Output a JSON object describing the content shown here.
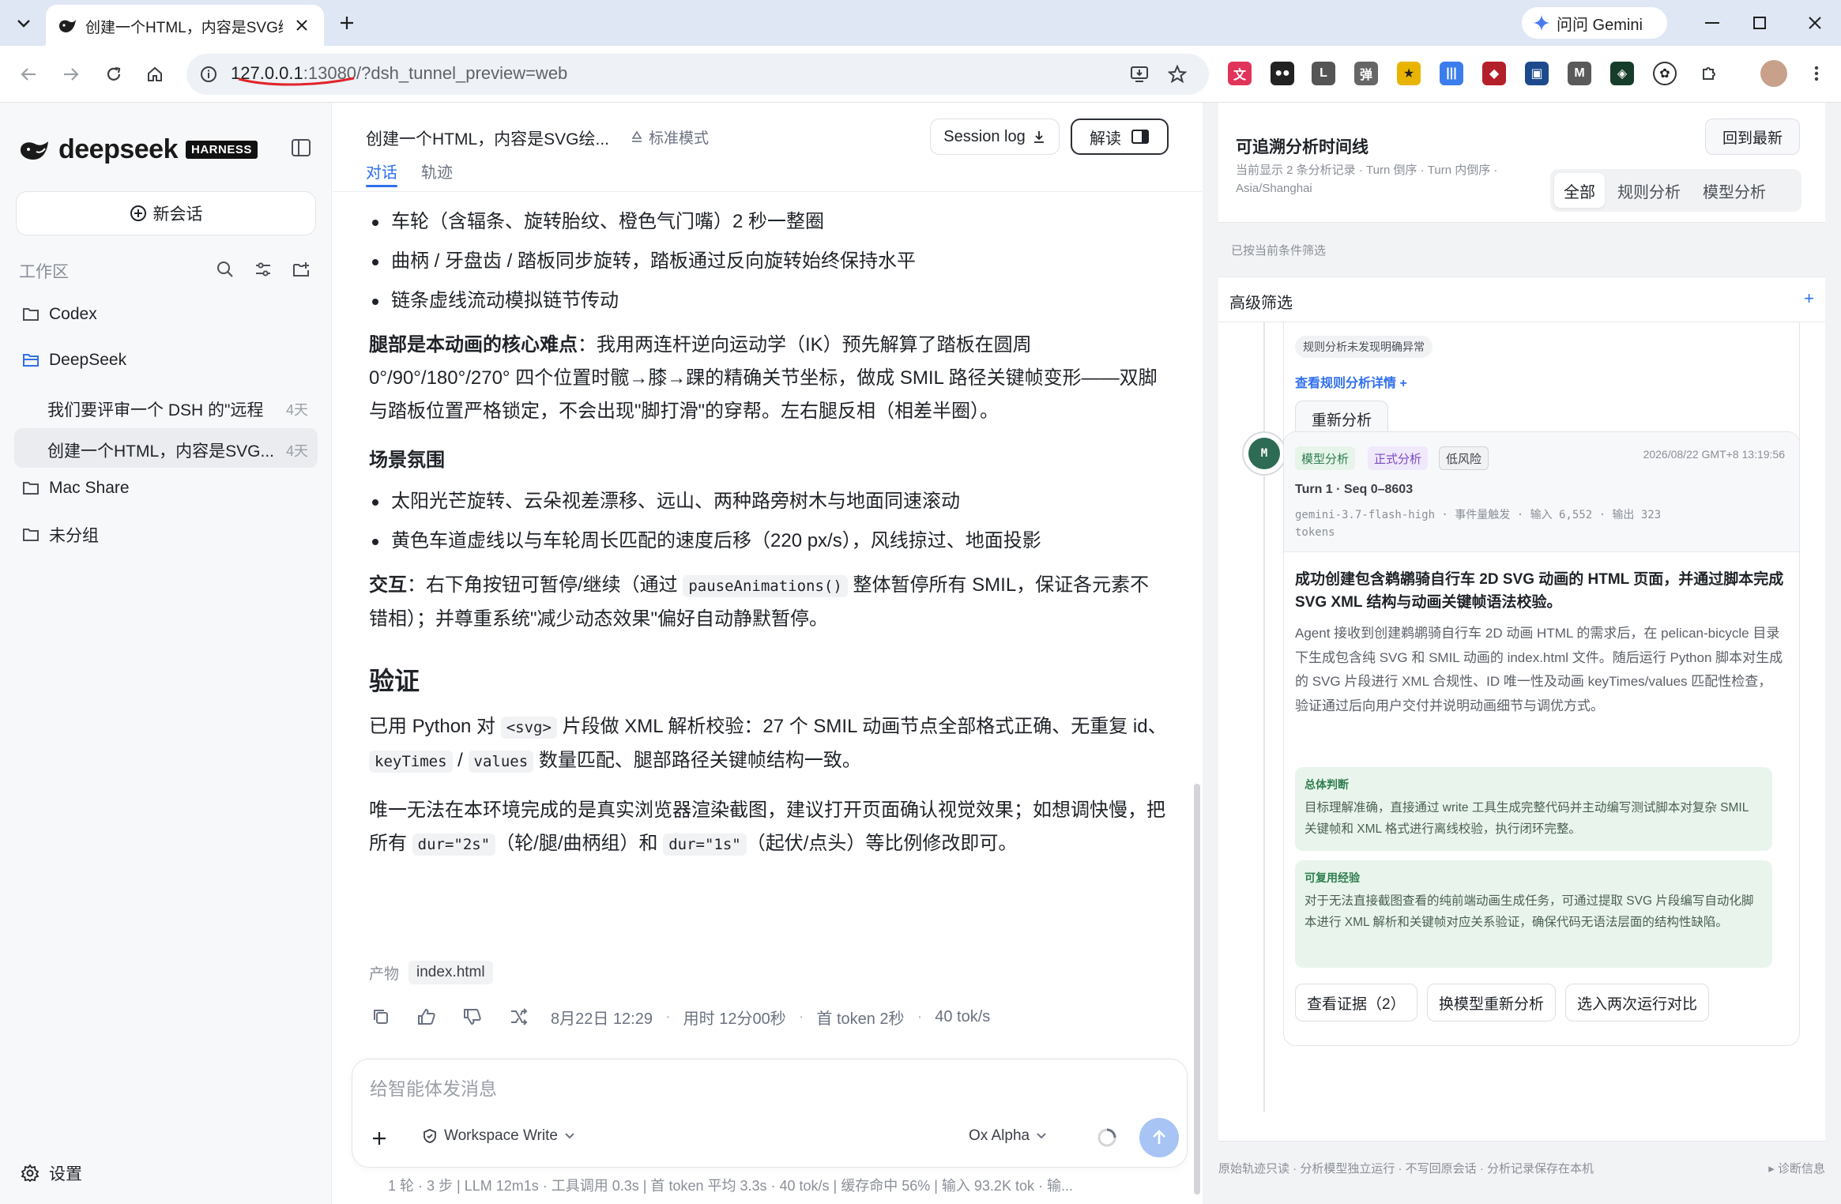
{
  "browser": {
    "tab_title": "创建一个HTML，内容是SVG绘",
    "gemini_label": "问问 Gemini",
    "url_host": "127.0.0.1",
    "url_rest": ":13080/?dsh_tunnel_preview=web"
  },
  "sidebar": {
    "brand": "deepseek",
    "badge": "HARNESS",
    "new_chat": "新会话",
    "workspace_label": "工作区",
    "folders": [
      {
        "label": "Codex"
      },
      {
        "label": "DeepSeek"
      },
      {
        "label": "Mac Share"
      },
      {
        "label": "未分组"
      }
    ],
    "conversations": [
      {
        "title": "我们要评审一个 DSH 的\"远程",
        "age": "4天"
      },
      {
        "title": "创建一个HTML，内容是SVG...",
        "age": "4天"
      }
    ],
    "settings": "设置"
  },
  "center": {
    "chat_title": "创建一个HTML，内容是SVG绘...",
    "mode": "标准模式",
    "session_log": "Session log",
    "interpret": "解读",
    "tabs": [
      "对话",
      "轨迹"
    ],
    "bullets1": [
      "车轮（含辐条、旋转胎纹、橙色气门嘴）2 秒一整圈",
      "曲柄 / 牙盘齿 / 踏板同步旋转，踏板通过反向旋转始终保持水平",
      "链条虚线流动模拟链节传动"
    ],
    "legs_bold": "腿部是本动画的核心难点",
    "legs_text": "：我用两连杆逆向运动学（IK）预先解算了踏板在圆周 0°/90°/180°/270° 四个位置时髋→膝→踝的精确关节坐标，做成 SMIL 路径关键帧变形——双脚与踏板位置严格锁定，不会出现\"脚打滑\"的穿帮。左右腿反相（相差半圈）。",
    "scene_heading": "场景氛围",
    "bullets2": [
      "太阳光芒旋转、云朵视差漂移、远山、两种路旁树木与地面同速滚动",
      "黄色车道虚线以与车轮周长匹配的速度后移（220 px/s），风线掠过、地面投影"
    ],
    "interact_bold": "交互",
    "interact_1": "：右下角按钮可暂停/继续（通过 ",
    "interact_code": "pauseAnimations()",
    "interact_2": " 整体暂停所有 SMIL，保证各元素不错相）；并尊重系统\"减少动态效果\"偏好自动静默暂停。",
    "verify_heading": "验证",
    "verify_1": "已用 Python 对 ",
    "verify_code1": "<svg>",
    "verify_2": " 片段做 XML 解析校验：27 个 SMIL 动画节点全部格式正确、无重复 id、",
    "verify_code2": "keyTimes",
    "verify_3": " / ",
    "verify_code3": "values",
    "verify_4": " 数量匹配、腿部路径关键帧结构一致。",
    "note_1": "唯一无法在本环境完成的是真实浏览器渲染截图，建议打开页面确认视觉效果；如想调快慢，把所有 ",
    "note_code1": "dur=\"2s\"",
    "note_2": "（轮/腿/曲柄组）和 ",
    "note_code2": "dur=\"1s\"",
    "note_3": "（起伏/点头）等比例修改即可。",
    "artifact_label": "产物",
    "artifact_file": "index.html",
    "meta_time": "8月22日 12:29",
    "meta_duration": "用时 12分00秒",
    "meta_first_token": "首 token 2秒",
    "meta_speed": "40 tok/s",
    "composer_placeholder": "给智能体发消息",
    "workspace_write": "Workspace Write",
    "model": "Ox Alpha",
    "stats": "1 轮 · 3 步  |  LLM 12m1s · 工具调用 0.3s  |  首 token 平均 3.3s · 40 tok/s  |  缓存命中 56%  |  输入 93.2K tok · 输..."
  },
  "panel": {
    "title": "可追溯分析时间线",
    "subtitle": "当前显示 2 条分析记录 · Turn 倒序 · Turn 内倒序 · Asia/Shanghai",
    "back_latest": "回到最新",
    "filters": [
      "全部",
      "规则分析",
      "模型分析"
    ],
    "filter_note": "已按当前条件筛选",
    "advanced": "高级筛选",
    "rule_chip": "规则分析未发现明确异常",
    "rule_detail": "查看规则分析详情 +",
    "reanalyze": "重新分析",
    "node": "M",
    "badges": [
      "模型分析",
      "正式分析",
      "低风险"
    ],
    "timestamp": "2026/08/22 GMT+8 13:19:56",
    "turn": "Turn 1 · Seq 0–8603",
    "model_line": "gemini-3.7-flash-high · 事件量触发 · 输入 6,552 · 输出 323 tokens",
    "headline": "成功创建包含鹈鹕骑自行车 2D SVG 动画的 HTML 页面，并通过脚本完成 SVG XML 结构与动画关键帧语法校验。",
    "body": "Agent 接收到创建鹈鹕骑自行车 2D 动画 HTML 的需求后，在 pelican-bicycle 目录下生成包含纯 SVG 和 SMIL 动画的 index.html 文件。随后运行 Python 脚本对生成的 SVG 片段进行 XML 合规性、ID 唯一性及动画 keyTimes/values 匹配性检查，验证通过后向用户交付并说明动画细节与调优方式。",
    "overall_h": "总体判断",
    "overall_d": "目标理解准确，直接通过 write 工具生成完整代码并主动编写测试脚本对复杂 SMIL 关键帧和 XML 格式进行离线校验，执行闭环完整。",
    "reuse_h": "可复用经验",
    "reuse_d": "对于无法直接截图查看的纯前端动画生成任务，可通过提取 SVG 片段编写自动化脚本进行 XML 解析和关键帧对应关系验证，确保代码无语法层面的结构性缺陷。",
    "btn_evidence": "查看证据（2）",
    "btn_switch": "换模型重新分析",
    "btn_compare": "选入两次运行对比",
    "footer": "原始轨迹只读 · 分析模型独立运行 · 不写回原会话 · 分析记录保存在本机",
    "diag": "▸ 诊断信息"
  }
}
